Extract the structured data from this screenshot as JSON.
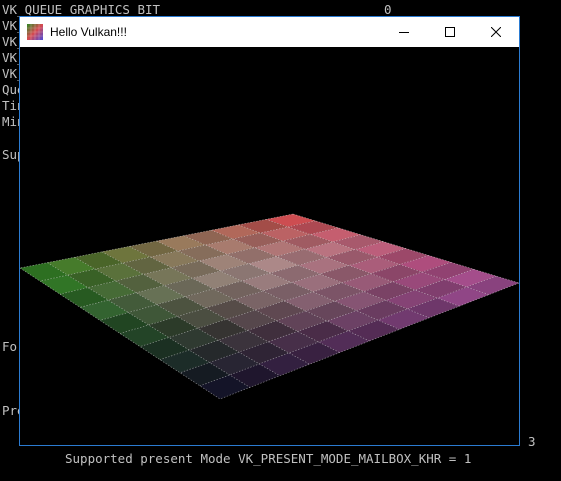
{
  "console": {
    "lines": [
      "VK_QUEUE_GRAPHICS_BIT",
      "VK_",
      "VK_",
      "VK_",
      "VK_",
      "Que",
      "Tin",
      "Min",
      "Sup",
      "For",
      "Pre",
      "Supported present Mode VK_PRESENT_MODE_MAILBOX_KHR = 1"
    ],
    "graphics_bit_value": "0",
    "side_value": "3"
  },
  "window": {
    "title": "Hello Vulkan!!!",
    "minimize_label": "Minimize",
    "maximize_label": "Maximize",
    "close_label": "Close"
  },
  "scene": {
    "grid_divisions": 10,
    "corner_colors": {
      "back": "#d84a50",
      "left": "#2e8a24",
      "right": "#a4509c",
      "front": "#0b0a22"
    },
    "center_color": "#d8d4d6",
    "accent": "#2b7bd1"
  }
}
